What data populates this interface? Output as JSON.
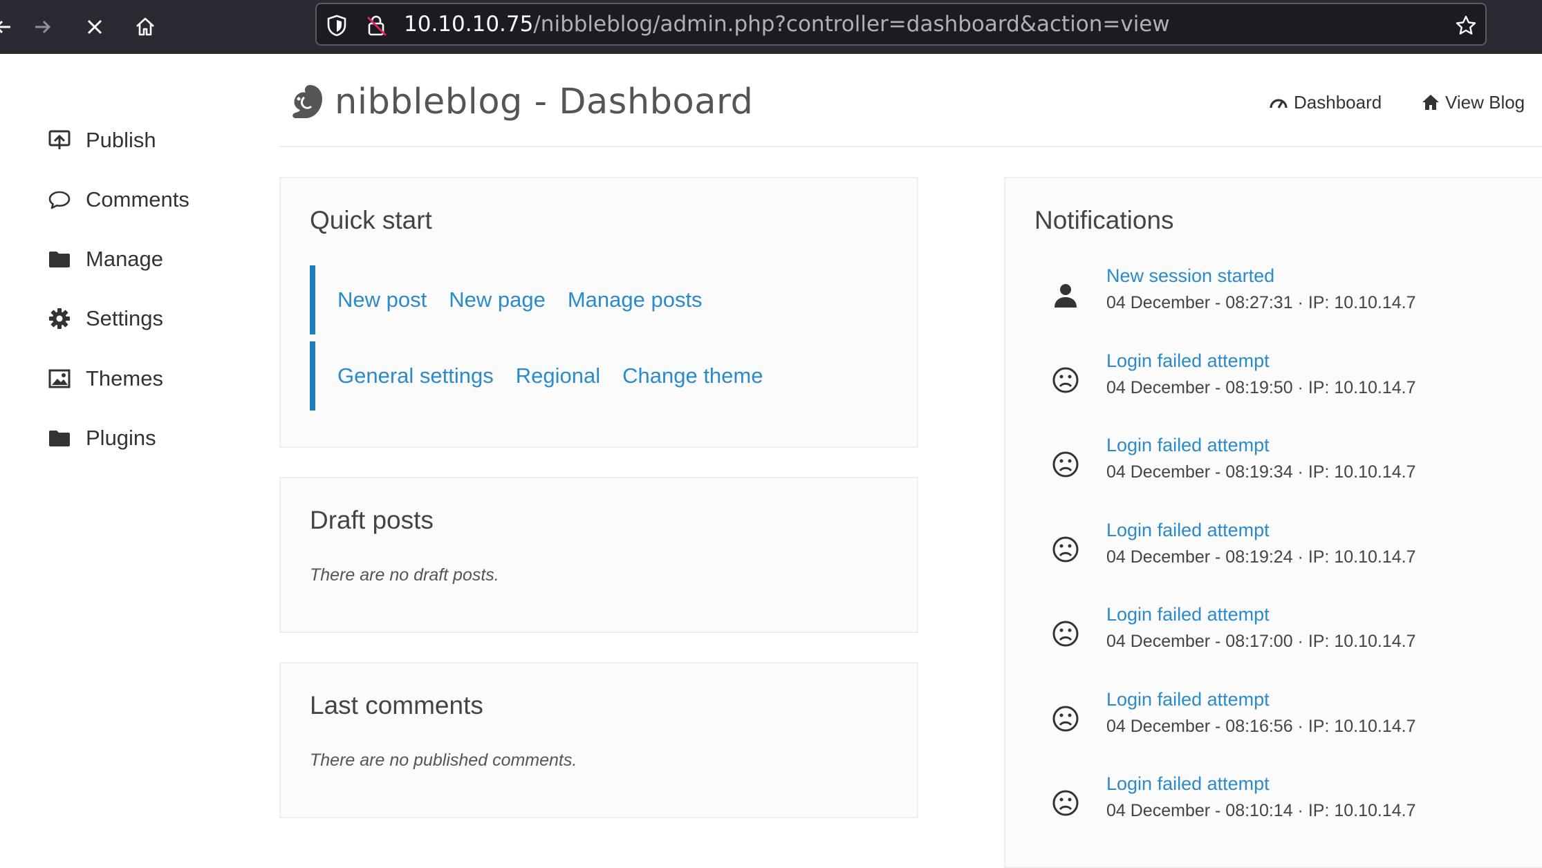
{
  "browser": {
    "url_host": "10.10.10.75",
    "url_path": "/nibbleblog/admin.php?controller=dashboard&action=view",
    "icons": [
      "back-arrow-icon",
      "forward-arrow-icon",
      "stop-loading-icon",
      "home-icon",
      "shield-icon",
      "insecure-lock-icon",
      "bookmark-star-icon"
    ]
  },
  "header": {
    "title": "nibbleblog - Dashboard",
    "links": [
      {
        "label": "Dashboard",
        "icon": "gauge-icon"
      },
      {
        "label": "View Blog",
        "icon": "home-icon"
      }
    ]
  },
  "sidebar": {
    "items": [
      {
        "label": "Publish",
        "icon": "publish-icon"
      },
      {
        "label": "Comments",
        "icon": "comment-bubble-icon"
      },
      {
        "label": "Manage",
        "icon": "folder-icon"
      },
      {
        "label": "Settings",
        "icon": "gear-icon"
      },
      {
        "label": "Themes",
        "icon": "image-icon"
      },
      {
        "label": "Plugins",
        "icon": "folder-icon"
      }
    ]
  },
  "quick_start": {
    "title": "Quick start",
    "row1": [
      "New post",
      "New page",
      "Manage posts"
    ],
    "row2": [
      "General settings",
      "Regional",
      "Change theme"
    ]
  },
  "draft_posts": {
    "title": "Draft posts",
    "message": "There are no draft posts."
  },
  "last_comments": {
    "title": "Last comments",
    "message": "There are no published comments."
  },
  "notifications": {
    "title": "Notifications",
    "items": [
      {
        "title": "New session started",
        "detail": "04 December - 08:27:31 · IP: 10.10.14.7",
        "icon": "user-icon"
      },
      {
        "title": "Login failed attempt",
        "detail": "04 December - 08:19:50 · IP: 10.10.14.7",
        "icon": "sad-face-icon"
      },
      {
        "title": "Login failed attempt",
        "detail": "04 December - 08:19:34 · IP: 10.10.14.7",
        "icon": "sad-face-icon"
      },
      {
        "title": "Login failed attempt",
        "detail": "04 December - 08:19:24 · IP: 10.10.14.7",
        "icon": "sad-face-icon"
      },
      {
        "title": "Login failed attempt",
        "detail": "04 December - 08:17:00 · IP: 10.10.14.7",
        "icon": "sad-face-icon"
      },
      {
        "title": "Login failed attempt",
        "detail": "04 December - 08:16:56 · IP: 10.10.14.7",
        "icon": "sad-face-icon"
      },
      {
        "title": "Login failed attempt",
        "detail": "04 December - 08:10:14 · IP: 10.10.14.7",
        "icon": "sad-face-icon"
      }
    ]
  },
  "colors": {
    "link": "#2a8acb",
    "accent_bar": "#1d7fc0",
    "chrome_bg": "#2b2a33"
  }
}
